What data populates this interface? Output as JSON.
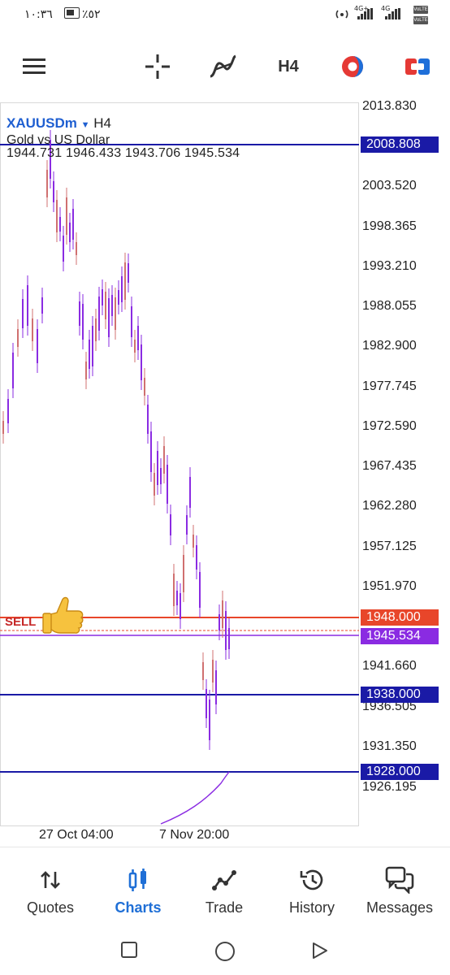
{
  "status_bar": {
    "time": "١٠:٣٦",
    "battery": "٪٥٢",
    "network_1": "4G+",
    "network_2": "4G",
    "volte_1": "VoLTE",
    "volte_2": "VoLTE"
  },
  "toolbar": {
    "menu_icon": "hamburger-icon",
    "crosshair_icon": "crosshair-icon",
    "indicators_icon": "indicators-icon",
    "timeframe": "H4",
    "theme_icon": "color-scheme-icon",
    "trade_icon": "one-click-trade-icon"
  },
  "chart": {
    "symbol": "XAUUSDm",
    "symbol_caret": "▼",
    "timeframe": "H4",
    "description": "Gold vs US Dollar",
    "ohlc": "1944.731 1946.433 1943.706 1945.534",
    "price_axis": [
      "2013.830",
      "2003.520",
      "1998.365",
      "1993.210",
      "1988.055",
      "1982.900",
      "1977.745",
      "1972.590",
      "1967.435",
      "1962.280",
      "1957.125",
      "1951.970",
      "1941.660",
      "1936.505",
      "1931.350",
      "1926.195"
    ],
    "tags": {
      "top_line": "2008.808",
      "sell_line": "1948.000",
      "current": "1945.534",
      "mid_line": "1938.000",
      "low_line": "1928.000"
    },
    "dates": [
      "27 Oct 04:00",
      "7 Nov 20:00"
    ],
    "sell_label": "SELL",
    "colors": {
      "blue_line": "#1a1aa6",
      "sell_line": "#e8462a",
      "current_tag": "#8a2be2",
      "bull": "#8a2be2",
      "bear": "#d07070"
    }
  },
  "bottom_nav": {
    "items": [
      {
        "label": "Quotes",
        "icon": "quotes-icon"
      },
      {
        "label": "Charts",
        "icon": "charts-icon",
        "active": true
      },
      {
        "label": "Trade",
        "icon": "trade-icon"
      },
      {
        "label": "History",
        "icon": "history-icon"
      },
      {
        "label": "Messages",
        "icon": "messages-icon"
      }
    ]
  },
  "system_nav": {
    "recent": "recent-apps-icon",
    "home": "home-icon",
    "back": "back-icon"
  }
}
